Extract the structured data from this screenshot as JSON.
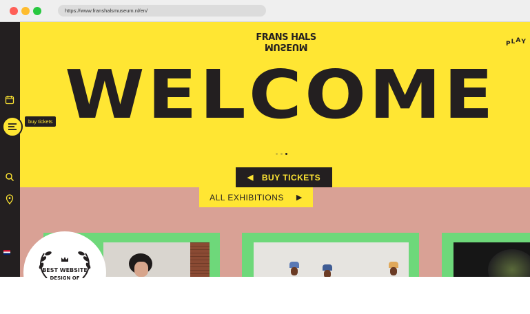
{
  "browser": {
    "url": "https://www.franshalsmuseum.nl/en/"
  },
  "header": {
    "logo_top": "FRANS HALS",
    "logo_bottom": "MUSEUM",
    "play": [
      "P",
      "L",
      "A",
      "Y"
    ]
  },
  "hero": {
    "title": "WELCOME",
    "carousel_dots": 3,
    "active_dot": 3
  },
  "sidebar": {
    "items": [
      {
        "icon": "calendar-icon"
      },
      {
        "icon": "ticket-icon"
      },
      {
        "icon": "menu-icon"
      },
      {
        "icon": "search-icon"
      },
      {
        "icon": "location-pin-icon"
      }
    ],
    "tooltip": "buy tickets",
    "language_flag": "uk-flag-icon"
  },
  "buttons": {
    "buy_tickets": "BUY TICKETS",
    "all_exhibitions": "ALL EXHIBITIONS"
  },
  "badge": {
    "line1": "BEST WEBSITE",
    "line2": "DESIGN OF"
  },
  "colors": {
    "yellow": "#ffe633",
    "dark": "#231f20",
    "pink": "#d9a195",
    "green": "#6ed87a"
  }
}
